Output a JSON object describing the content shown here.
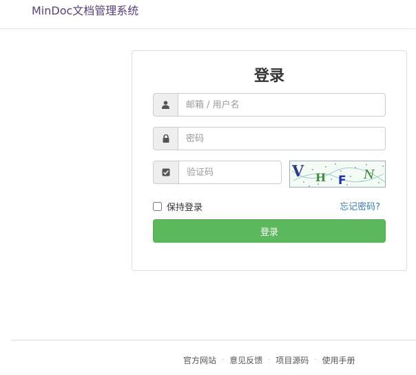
{
  "brand": {
    "name": "MinDoc文档管理系统"
  },
  "login": {
    "title": "登录",
    "account_placeholder": "邮箱 / 用户名",
    "account_icon": "user-icon",
    "password_placeholder": "密码",
    "password_icon": "lock-icon",
    "captcha_placeholder": "验证码",
    "captcha_icon": "check-square-icon",
    "captcha_image_text": "VHFN",
    "remember_label": "保持登录",
    "forgot_link": "忘记密码?",
    "submit_label": "登录"
  },
  "footer": {
    "links": [
      "官方网站",
      "意见反馈",
      "项目源码",
      "使用手册"
    ],
    "separator": "·"
  },
  "colors": {
    "brand": "#563d7c",
    "submit": "#5cb85c",
    "link": "#337ab7"
  }
}
